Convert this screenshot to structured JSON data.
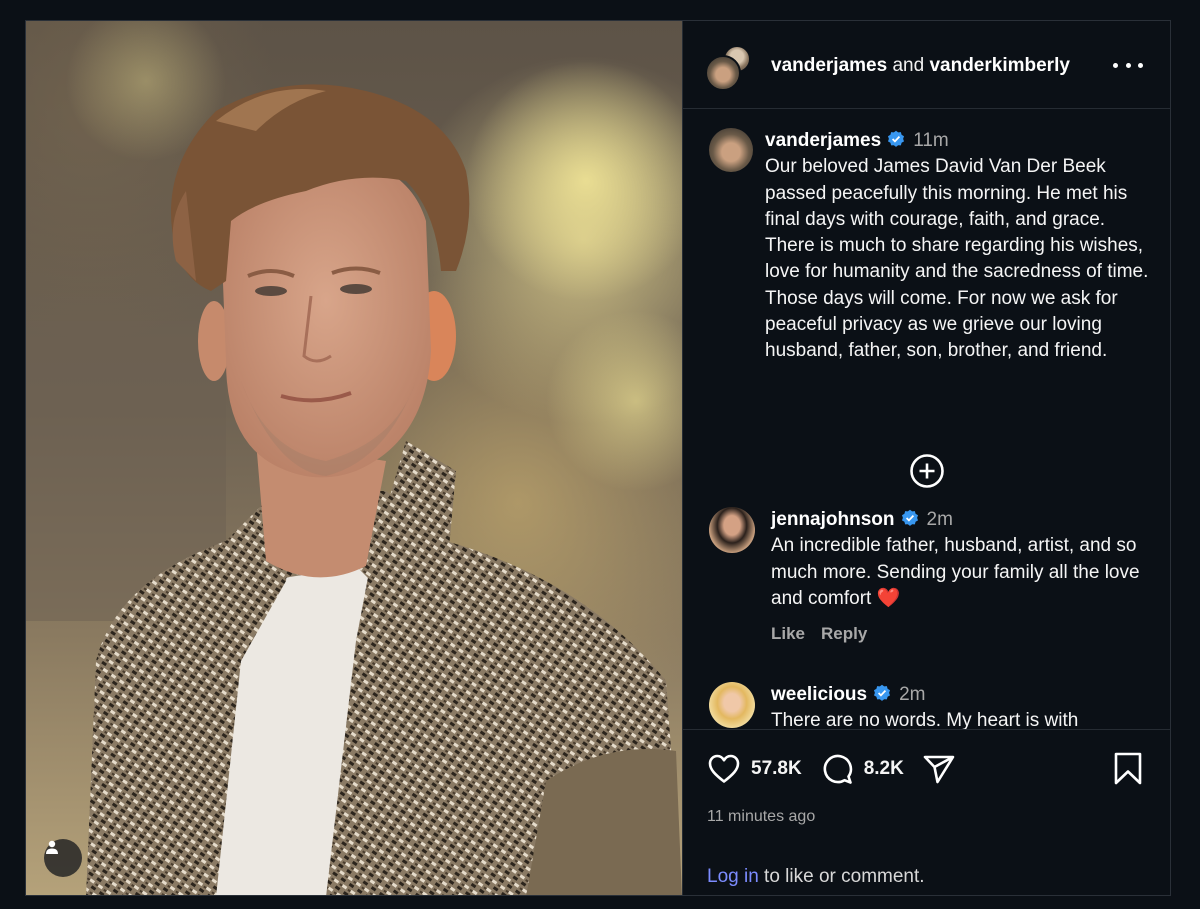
{
  "header": {
    "user1": "vanderjames",
    "joiner": "and",
    "user2": "vanderkimberly"
  },
  "caption": {
    "username": "vanderjames",
    "time": "11m",
    "text": "Our beloved James David Van Der Beek passed peacefully this morning.  He met his final days with courage, faith, and grace.  There is much to share regarding his wishes, love for humanity and the sacredness of time.  Those days will come.  For now we ask for peaceful privacy as we grieve our loving husband, father, son, brother, and friend."
  },
  "comments": [
    {
      "username": "jennajohnson",
      "time": "2m",
      "text": "An incredible father, husband, artist, and so much more. Sending your family all the love and comfort",
      "emoji": "❤️",
      "like_label": "Like",
      "reply_label": "Reply"
    },
    {
      "username": "weelicious",
      "time": "2m",
      "text": "There are no words. My heart is with"
    }
  ],
  "actions": {
    "likes": "57.8K",
    "comments": "8.2K"
  },
  "post_time": "11 minutes ago",
  "login": {
    "link": "Log in",
    "rest": " to like or comment."
  },
  "colors": {
    "background": "#0b1016",
    "verified": "#3897f0",
    "link": "#7c8cff"
  }
}
